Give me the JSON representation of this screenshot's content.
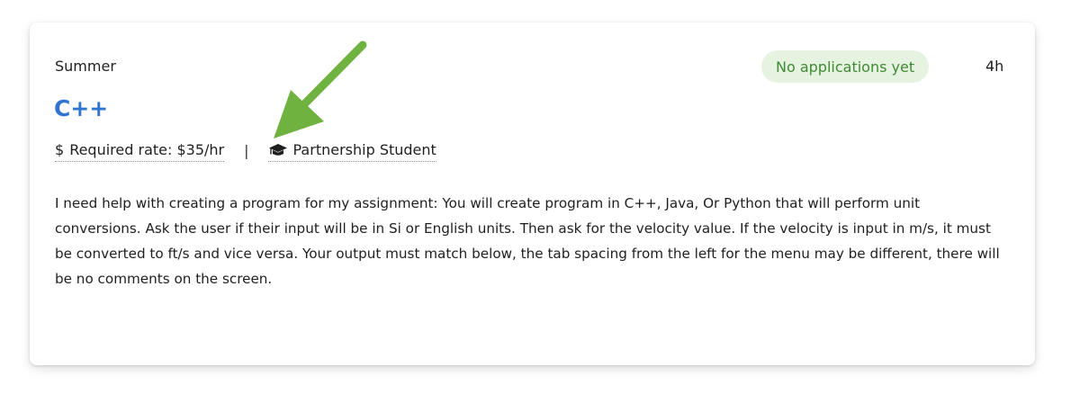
{
  "card": {
    "category": "Summer",
    "title": "C++",
    "rate": {
      "icon": "$",
      "label": "Required rate: $35/hr"
    },
    "separator": "|",
    "student_type": {
      "icon": "graduation-cap-icon",
      "label": "Partnership Student"
    },
    "status_badge": "No applications yet",
    "time_ago": "4h",
    "description": "I need help with creating a program for my assignment: You will create program in C++, Java, Or Python that will perform unit conversions. Ask the user if their input will be in Si or English units. Then ask for the velocity value. If the velocity is input in m/s, it must be converted to ft/s and vice versa. Your output must match below, the tab spacing from the left for the menu may be different, there will be no comments on the screen."
  },
  "annotation": {
    "icon": "green-arrow-icon",
    "color": "#6fb23f"
  },
  "colors": {
    "title": "#2f74d0",
    "badge_bg": "#e6f3e0",
    "badge_text": "#3f8a34"
  }
}
